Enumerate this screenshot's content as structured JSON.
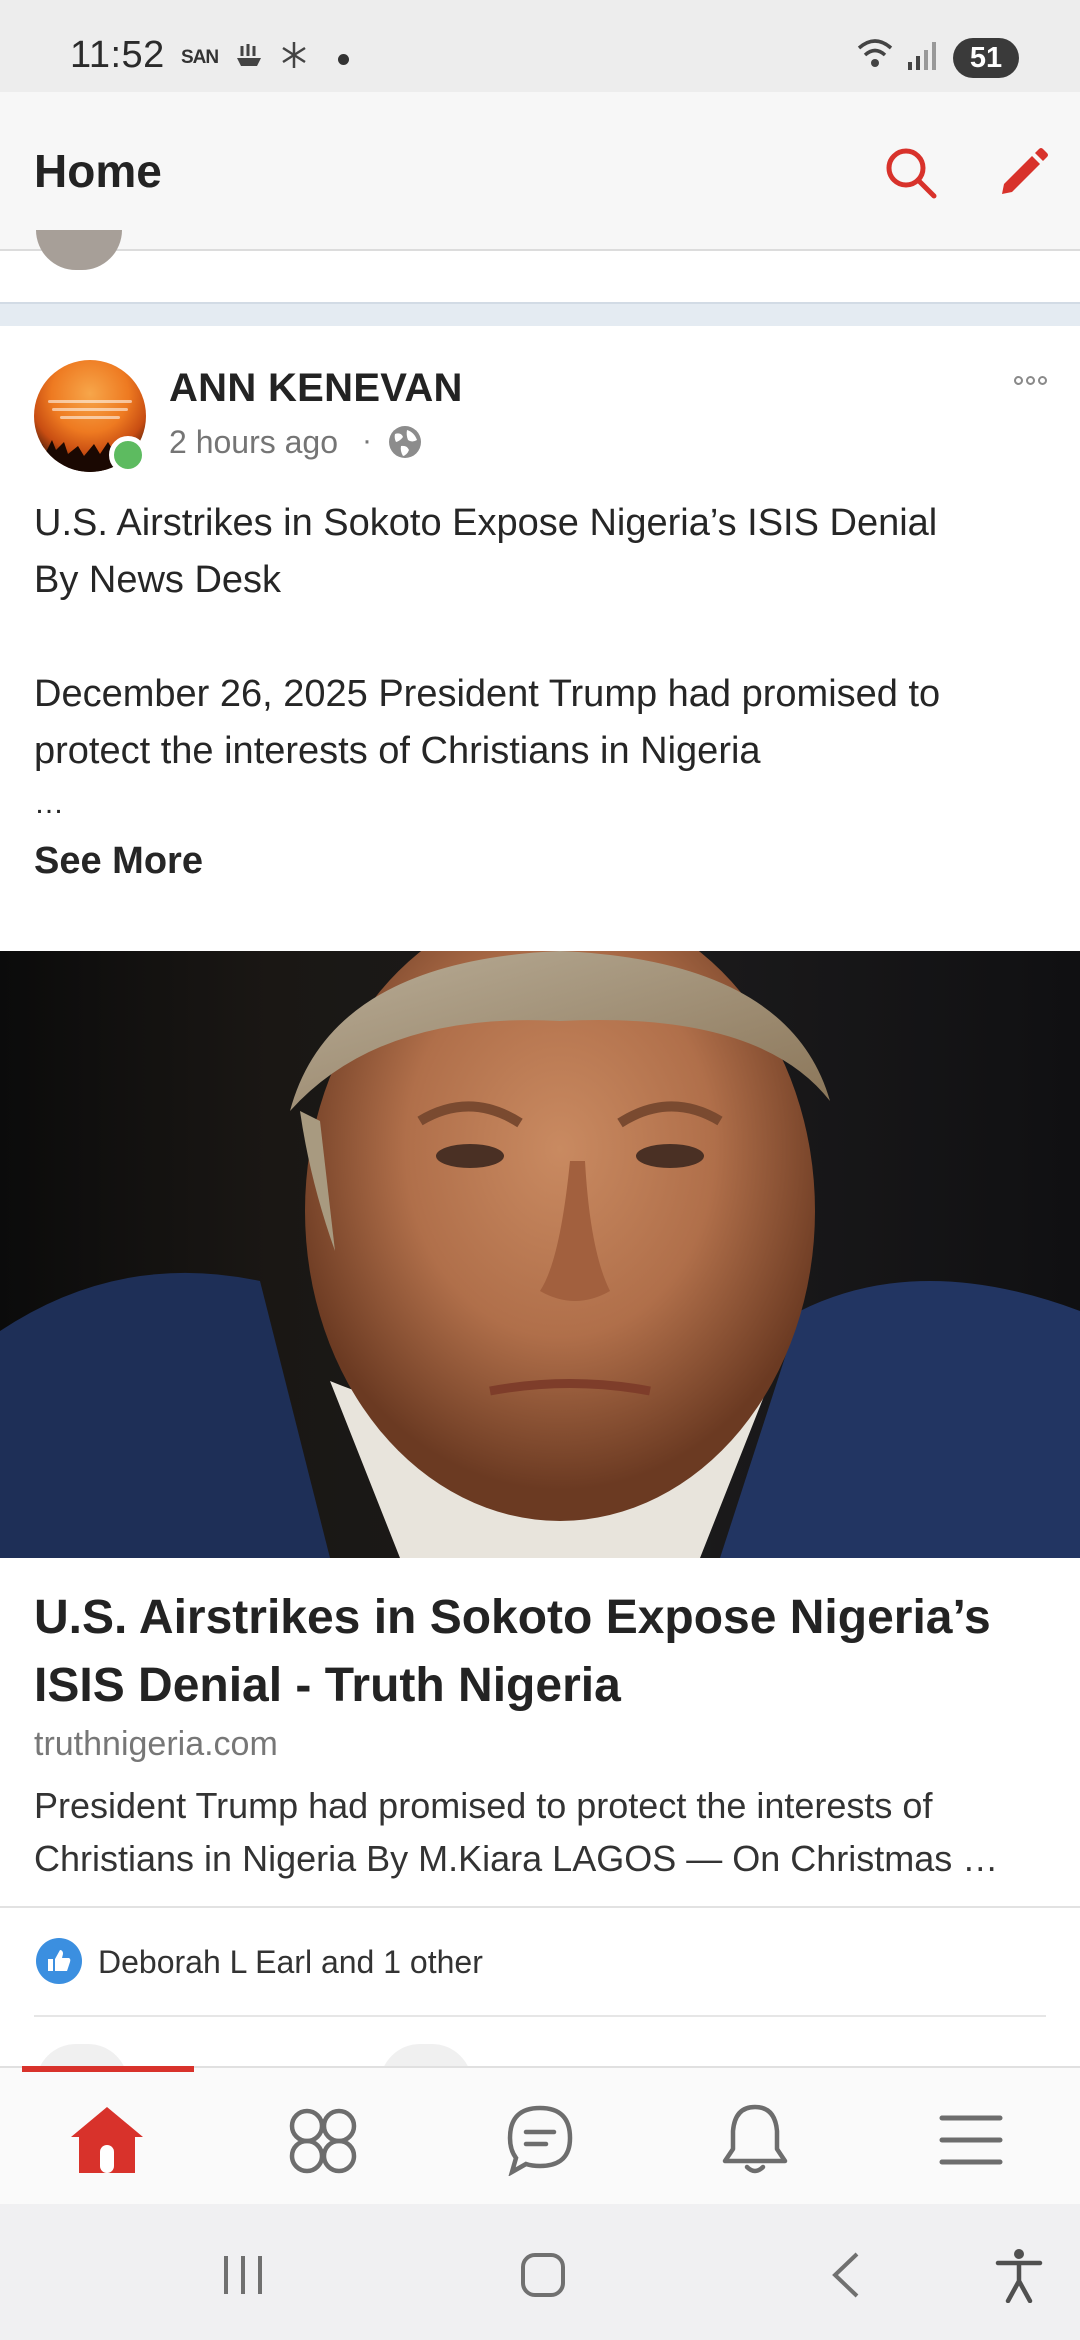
{
  "status_bar": {
    "time": "11:52",
    "carrier": "SAN",
    "battery": "51",
    "icons": [
      "sailboat-icon",
      "snowflake-icon",
      "dot-icon",
      "wifi-icon",
      "signal-icon",
      "battery-icon"
    ]
  },
  "header": {
    "title": "Home",
    "actions": [
      {
        "name": "search",
        "icon": "search-icon"
      },
      {
        "name": "compose",
        "icon": "pencil-icon"
      }
    ]
  },
  "post": {
    "author": "ANN KENEVAN",
    "time": "2 hours ago",
    "separator": "·",
    "visibility_icon": "globe-icon",
    "body_lines": [
      "U.S. Airstrikes in Sokoto Expose Nigeria’s ISIS Denial",
      "By News Desk",
      "",
      "December 26, 2025 President Trump had promised to",
      "protect the interests of Christians in Nigeria",
      "…"
    ],
    "see_more": "See More",
    "link": {
      "title": "U.S. Airstrikes in Sokoto Expose Nigeria’s ISIS Denial - Truth Nigeria",
      "domain": "truthnigeria.com",
      "description_lines": [
        "President Trump had promised to protect the interests of",
        "Christians in Nigeria By M.Kiara LAGOS — On Christmas …"
      ]
    },
    "reactions": {
      "icon": "thumbs-up-icon",
      "text": "Deborah L Earl and 1 other"
    }
  },
  "bottom_nav": {
    "items": [
      {
        "name": "home",
        "icon": "home-icon",
        "active": true
      },
      {
        "name": "groups",
        "icon": "groups-icon",
        "active": false
      },
      {
        "name": "messages",
        "icon": "chat-icon",
        "active": false
      },
      {
        "name": "notifications",
        "icon": "bell-icon",
        "active": false
      },
      {
        "name": "menu",
        "icon": "menu-icon",
        "active": false
      }
    ]
  },
  "colors": {
    "accent": "#d8322b",
    "online": "#5dbb60",
    "like_blue": "#3b8fe0"
  }
}
